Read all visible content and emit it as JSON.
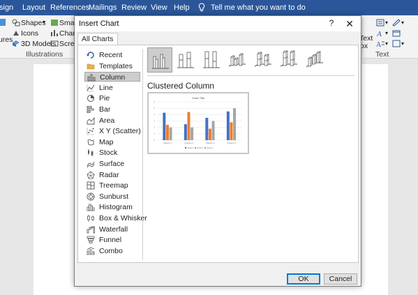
{
  "ribbon_tabs": [
    "sign",
    "Layout",
    "References",
    "Mailings",
    "Review",
    "View",
    "Help"
  ],
  "tell_me": "Tell me what you want to do",
  "ribbon": {
    "shapes": "Shapes",
    "icons": "Icons",
    "models_3d": "3D Models",
    "smartart": "SmartA",
    "chart": "Chart",
    "screenshot": "Screen",
    "ures": "ures",
    "illustrations_group": "Illustrations",
    "text_box_1": "Text",
    "text_box_2": "ox",
    "text_group": "Text"
  },
  "dialog": {
    "title": "Insert Chart",
    "help": "?",
    "close": "✕",
    "tab_all": "All Charts",
    "chart_types": [
      {
        "label": "Recent",
        "icon": "recent-icon"
      },
      {
        "label": "Templates",
        "icon": "templates-folder-icon"
      },
      {
        "label": "Column",
        "icon": "column-chart-icon"
      },
      {
        "label": "Line",
        "icon": "line-chart-icon"
      },
      {
        "label": "Pie",
        "icon": "pie-chart-icon"
      },
      {
        "label": "Bar",
        "icon": "bar-chart-icon"
      },
      {
        "label": "Area",
        "icon": "area-chart-icon"
      },
      {
        "label": "X Y (Scatter)",
        "icon": "scatter-chart-icon"
      },
      {
        "label": "Map",
        "icon": "map-chart-icon"
      },
      {
        "label": "Stock",
        "icon": "stock-chart-icon"
      },
      {
        "label": "Surface",
        "icon": "surface-chart-icon"
      },
      {
        "label": "Radar",
        "icon": "radar-chart-icon"
      },
      {
        "label": "Treemap",
        "icon": "treemap-chart-icon"
      },
      {
        "label": "Sunburst",
        "icon": "sunburst-chart-icon"
      },
      {
        "label": "Histogram",
        "icon": "histogram-chart-icon"
      },
      {
        "label": "Box & Whisker",
        "icon": "box-whisker-chart-icon"
      },
      {
        "label": "Waterfall",
        "icon": "waterfall-chart-icon"
      },
      {
        "label": "Funnel",
        "icon": "funnel-chart-icon"
      },
      {
        "label": "Combo",
        "icon": "combo-chart-icon"
      }
    ],
    "selected_type": "Column",
    "subtypes": [
      "clustered-column",
      "stacked-column",
      "100-stacked-column",
      "3d-clustered-column",
      "3d-stacked-column",
      "3d-100-stacked-column",
      "3d-column"
    ],
    "selected_subtype": "Clustered Column",
    "preview": {
      "title": "Chart Title",
      "categories": [
        "Category 1",
        "Category 2",
        "Category 3",
        "Category 4"
      ],
      "series": [
        {
          "name": "Series 1",
          "color": "#4472c4",
          "values": [
            4.3,
            2.5,
            3.5,
            4.5
          ]
        },
        {
          "name": "Series 2",
          "color": "#ed7d31",
          "values": [
            2.4,
            4.4,
            1.8,
            2.8
          ]
        },
        {
          "name": "Series 3",
          "color": "#a5a5a5",
          "values": [
            2,
            2,
            3,
            5
          ]
        }
      ],
      "ylim": [
        0,
        6
      ]
    },
    "ok": "OK",
    "cancel": "Cancel"
  },
  "colors": {
    "ribbon_blue": "#2b579a",
    "selection_gray": "#cdcdcd",
    "ok_border": "#0078d7"
  }
}
